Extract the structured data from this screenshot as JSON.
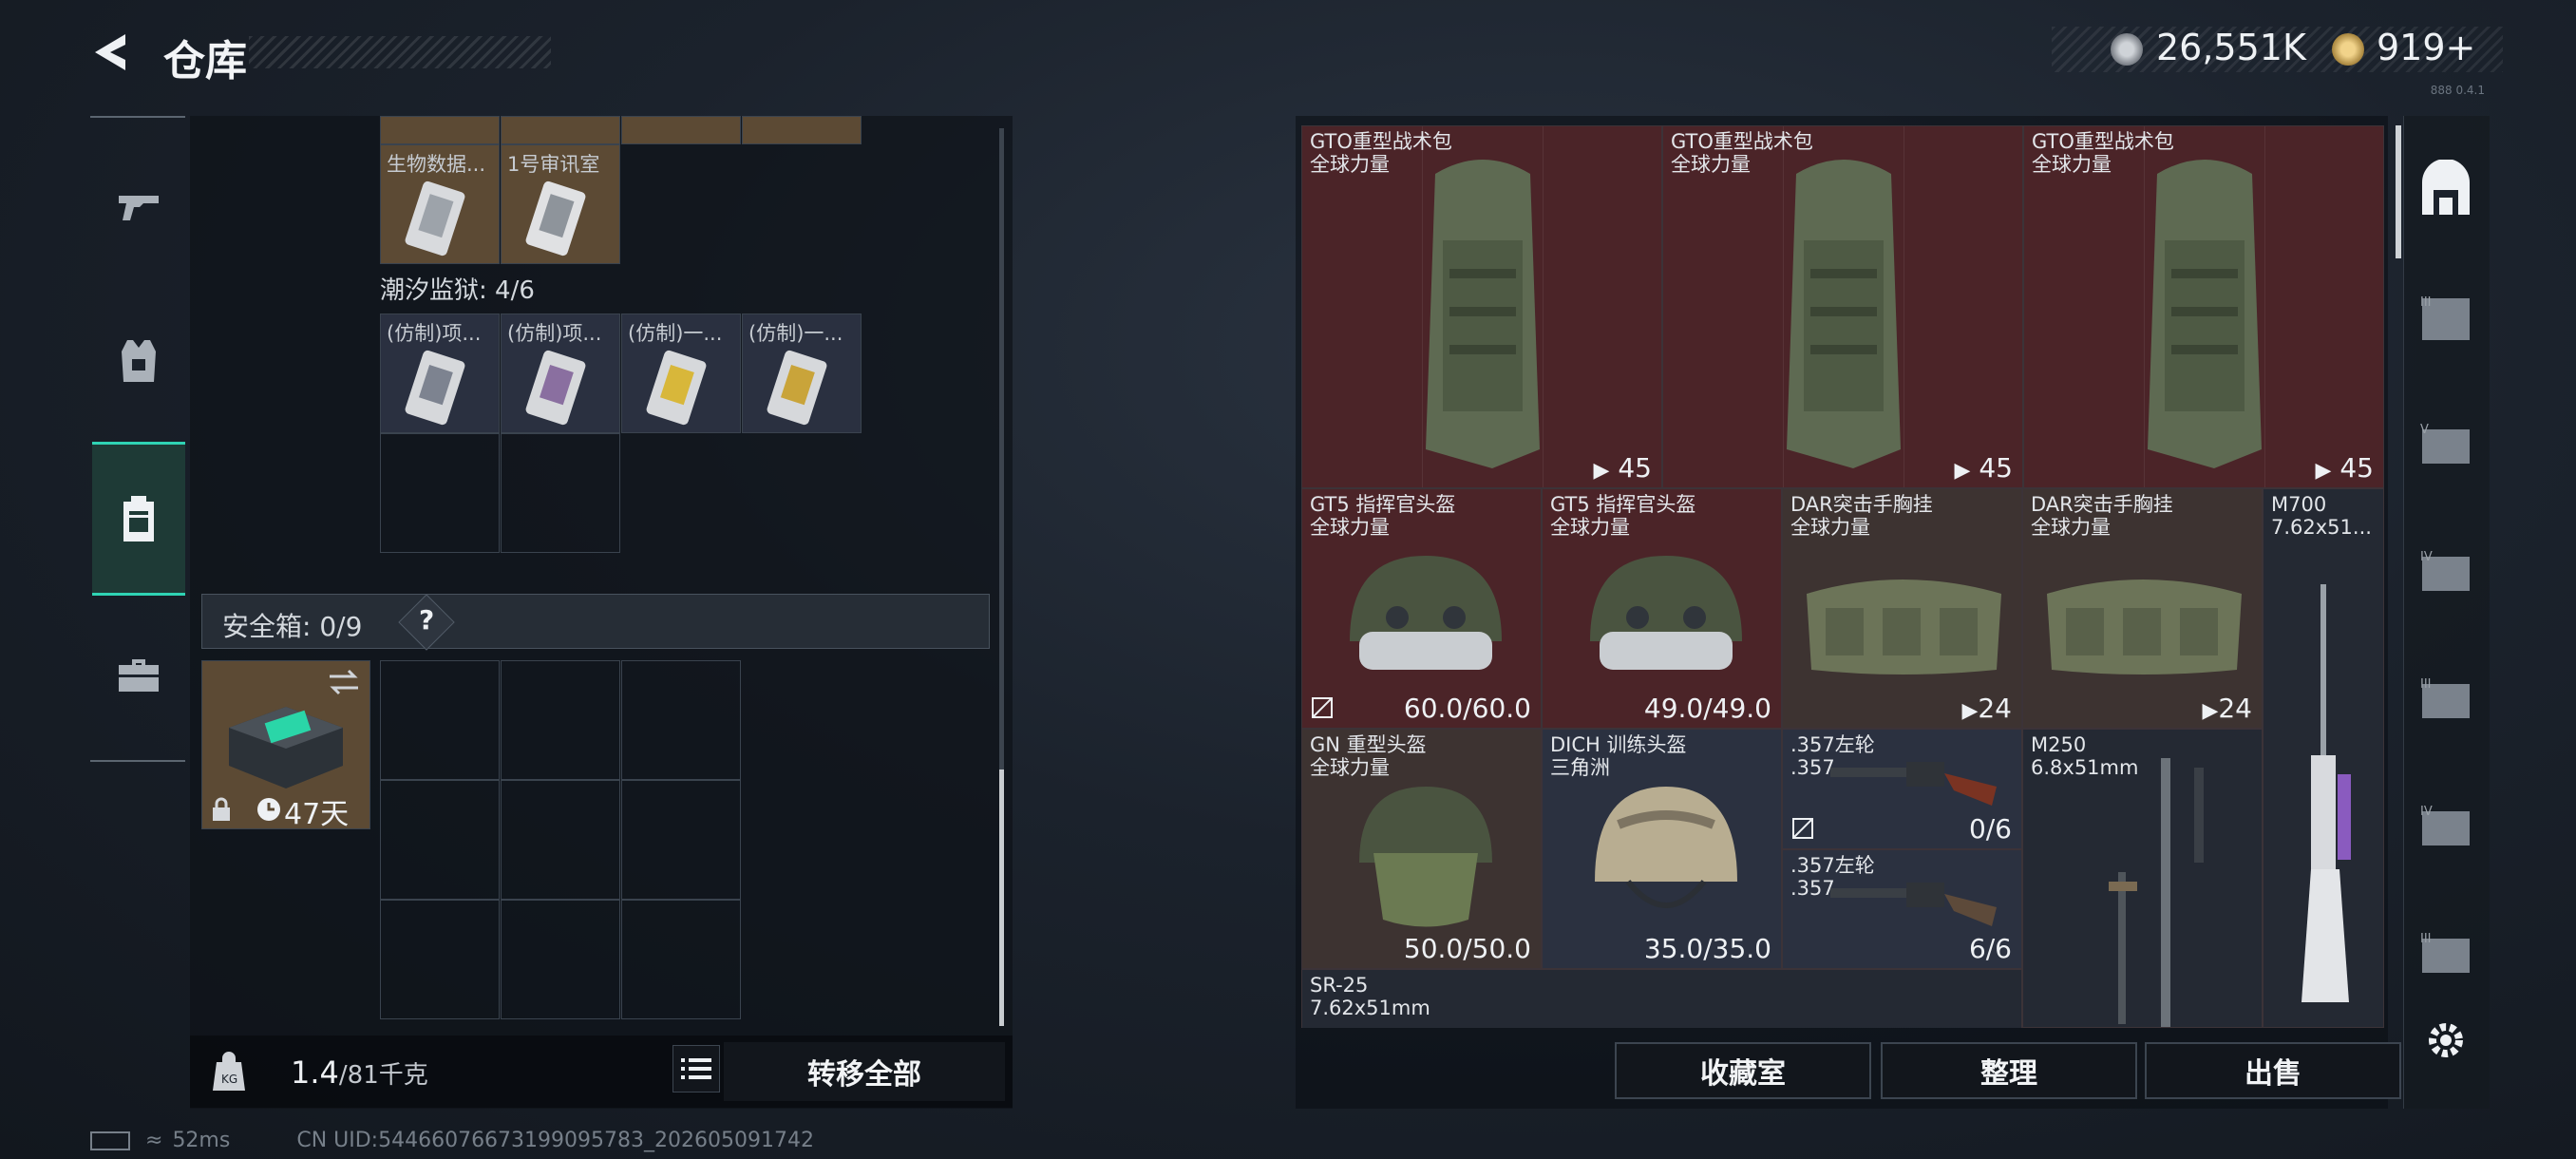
{
  "header": {
    "title": "仓库",
    "currency1": "26,551K",
    "currency2": "919+",
    "corner_text": "888 0.4.1"
  },
  "left": {
    "top_items": [
      {
        "label": "生物数据..."
      },
      {
        "label": "1号审讯室"
      }
    ],
    "section_title": "潮汐监狱: 4/6",
    "section_items": [
      {
        "label": "(仿制)项..."
      },
      {
        "label": "(仿制)项..."
      },
      {
        "label": "(仿制)一..."
      },
      {
        "label": "(仿制)一..."
      }
    ],
    "safe_box_label": "安全箱: 0/9",
    "safe_box_help": "?",
    "safe_case_days": "47天",
    "weight_value": "1.4",
    "weight_total": "/81千克",
    "transfer_all": "转移全部"
  },
  "right": {
    "items": [
      {
        "name": "GTO重型战术包",
        "sub": "全球力量",
        "value": "45"
      },
      {
        "name": "GTO重型战术包",
        "sub": "全球力量",
        "value": "45"
      },
      {
        "name": "GTO重型战术包",
        "sub": "全球力量",
        "value": "45"
      },
      {
        "name": "GT5 指挥官头盔",
        "sub": "全球力量",
        "value": "60.0/60.0"
      },
      {
        "name": "GT5 指挥官头盔",
        "sub": "全球力量",
        "value": "49.0/49.0"
      },
      {
        "name": "DAR突击手胸挂",
        "sub": "全球力量",
        "value": "24"
      },
      {
        "name": "DAR突击手胸挂",
        "sub": "全球力量",
        "value": "24"
      },
      {
        "name": "M700",
        "sub": "7.62x51..."
      },
      {
        "name": "GN 重型头盔",
        "sub": "全球力量",
        "value": "50.0/50.0"
      },
      {
        "name": "DICH 训练头盔",
        "sub": "三角洲",
        "value": "35.0/35.0"
      },
      {
        "name": ".357左轮",
        "sub": ".357",
        "value": "0/6"
      },
      {
        "name": ".357左轮",
        "sub": ".357",
        "value": "6/6"
      },
      {
        "name": "M250",
        "sub": "6.8x51mm"
      },
      {
        "name": "SR-25",
        "sub": "7.62x51mm"
      }
    ],
    "btn_collection": "收藏室",
    "btn_sort": "整理",
    "btn_sell": "出售"
  },
  "status": {
    "ping": "52ms",
    "uid": "CN UID:54466076673199095783_202605091742"
  }
}
